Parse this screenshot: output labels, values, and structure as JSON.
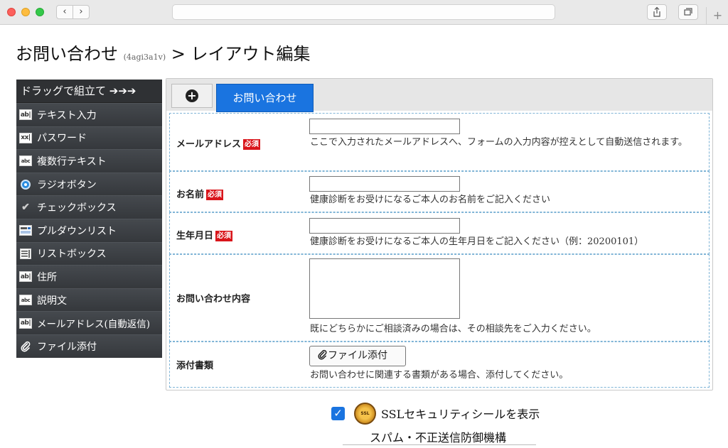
{
  "browser": {
    "back_label": "‹",
    "forward_label": "›",
    "new_tab_label": "+"
  },
  "page": {
    "title": "お問い合わせ",
    "form_id": "(4agi3a1v)",
    "title_suffix": " > レイアウト編集"
  },
  "palette": {
    "header": "ドラッグで組立て ➔➔➔",
    "items": [
      {
        "label": "テキスト入力",
        "icon": "text-input-icon",
        "glyph": "ab|"
      },
      {
        "label": "パスワード",
        "icon": "password-icon",
        "glyph": "xx|"
      },
      {
        "label": "複数行テキスト",
        "icon": "textarea-icon",
        "glyph": "abc"
      },
      {
        "label": "ラジオボタン",
        "icon": "radio-icon",
        "glyph": ""
      },
      {
        "label": "チェックボックス",
        "icon": "checkbox-icon",
        "glyph": "✔"
      },
      {
        "label": "プルダウンリスト",
        "icon": "dropdown-icon",
        "glyph": "▭"
      },
      {
        "label": "リストボックス",
        "icon": "listbox-icon",
        "glyph": "≣"
      },
      {
        "label": "住所",
        "icon": "address-icon",
        "glyph": "ab|"
      },
      {
        "label": "説明文",
        "icon": "description-icon",
        "glyph": "abc"
      },
      {
        "label": "メールアドレス(自動返信)",
        "icon": "email-autoreply-icon",
        "glyph": "ab|"
      },
      {
        "label": "ファイル添付",
        "icon": "paperclip-icon",
        "glyph": "🖇"
      }
    ]
  },
  "form": {
    "tab_label": "お問い合わせ",
    "required_label": "必須",
    "fields": [
      {
        "label": "メールアドレス",
        "required": true,
        "value": "",
        "help": "ここで入力されたメールアドレスへ、フォームの入力内容が控えとして自動送信されます。"
      },
      {
        "label": "お名前",
        "required": true,
        "value": "",
        "help": "健康診断をお受けになるご本人のお名前をご記入ください"
      },
      {
        "label": "生年月日",
        "required": true,
        "value": "",
        "help": "健康診断をお受けになるご本人の生年月日をご記入ください（例：20200101）"
      },
      {
        "label": "お問い合わせ内容",
        "required": false,
        "value": "",
        "help": "既にどちらかにご相談済みの場合は、その相談先をご入力ください。"
      },
      {
        "label": "添付書類",
        "required": false,
        "button": "ファイル添付",
        "help": "お問い合わせに関連する書類がある場合、添付してください。"
      }
    ]
  },
  "ssl": {
    "checked": true,
    "label": "SSLセキュリティシールを表示",
    "seal_text": "SSL"
  },
  "spam": {
    "label": "スパム・不正送信防御機構"
  },
  "colors": {
    "accent": "#1a74e0",
    "required": "#d9151b",
    "palette_bg": "#3c3f44"
  }
}
